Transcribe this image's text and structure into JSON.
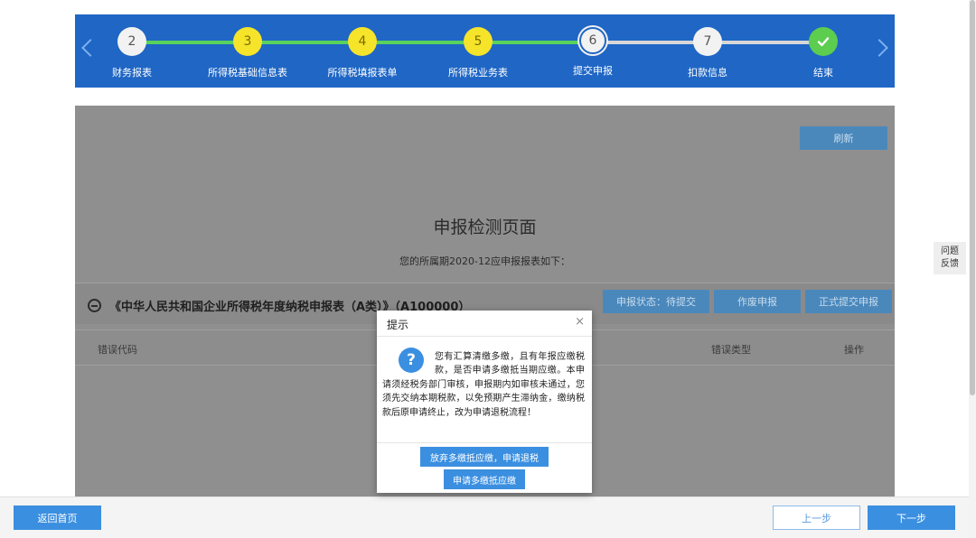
{
  "steps": [
    {
      "number": "2",
      "label": "财务报表",
      "state": "done"
    },
    {
      "number": "3",
      "label": "所得税基础信息表",
      "state": "done"
    },
    {
      "number": "4",
      "label": "所得税填报表单",
      "state": "done"
    },
    {
      "number": "5",
      "label": "所得税业务表",
      "state": "done"
    },
    {
      "number": "6",
      "label": "提交申报",
      "state": "current"
    },
    {
      "number": "7",
      "label": "扣款信息",
      "state": "todo"
    },
    {
      "number": "",
      "label": "结束",
      "state": "finish"
    }
  ],
  "main": {
    "refresh_label": "刷新",
    "title": "申报检测页面",
    "subtitle": "您的所属期2020-12应申报报表如下：",
    "report": {
      "name": "《中华人民共和国企业所得税年度纳税申报表（A类）》（A100000）",
      "status_label": "申报状态：待提交",
      "void_label": "作废申报",
      "submit_label": "正式提交申报"
    },
    "table_headers": {
      "code": "错误代码",
      "type": "错误类型",
      "op": "操作"
    }
  },
  "feedback": {
    "line1": "问题",
    "line2": "反馈"
  },
  "modal": {
    "title": "提示",
    "close": "×",
    "message": "您有汇算清缴多缴，且有年报应缴税款，是否申请多缴抵当期应缴。本申请须经税务部门审核，申报期内如审核未通过，您须先交纳本期税款，以免预期产生滞纳金，缴纳税款后原申请终止，改为申请退税流程！",
    "option1": "放弃多缴抵应缴，申请退税",
    "option2": "申请多缴抵应缴"
  },
  "footer": {
    "home_label": "返回首页",
    "prev_label": "上一步",
    "next_label": "下一步"
  },
  "colors": {
    "stepbar_bg": "#1f66c5",
    "step_done": "#f6e42a",
    "track_done": "#58d35c",
    "button_blue": "#3b8fe0"
  }
}
